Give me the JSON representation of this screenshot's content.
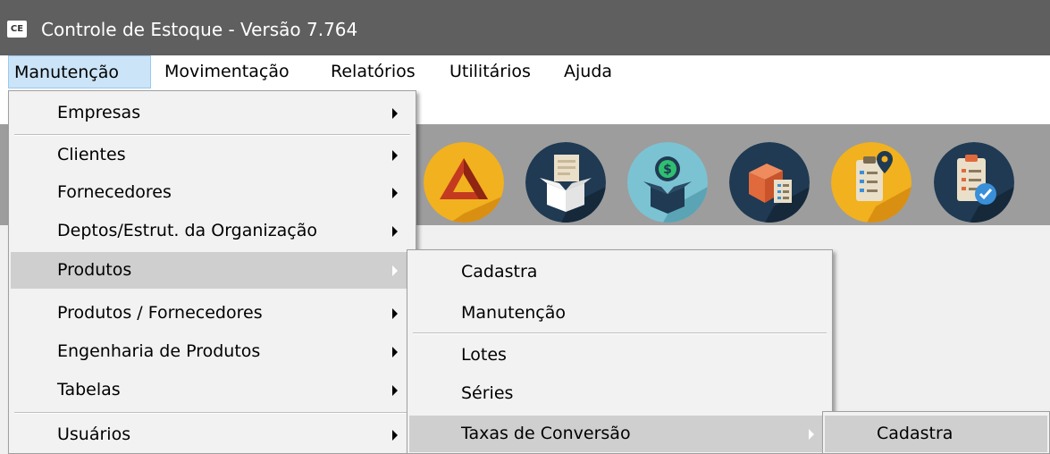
{
  "window": {
    "app_icon_text": "CE",
    "title": "Controle de Estoque - Versão 7.764"
  },
  "menubar": {
    "items": [
      "Manutenção",
      "Movimentação",
      "Relatórios",
      "Utilitários",
      "Ajuda"
    ],
    "active": "Manutenção"
  },
  "toolbar": {
    "icons": [
      "triangle-logo-icon",
      "open-box-document-icon",
      "box-dollar-icon",
      "box-checklist-icon",
      "clipboard-location-icon",
      "clipboard-check-icon"
    ]
  },
  "menu_manutencao": {
    "items": [
      "Empresas",
      "Clientes",
      "Fornecedores",
      "Deptos/Estrut. da Organização",
      "Produtos",
      "Produtos / Fornecedores",
      "Engenharia de Produtos",
      "Tabelas",
      "Usuários"
    ],
    "highlighted": "Produtos"
  },
  "menu_produtos": {
    "items": [
      "Cadastra",
      "Manutenção",
      "Lotes",
      "Séries",
      "Taxas de Conversão"
    ],
    "highlighted": "Taxas de Conversão"
  },
  "menu_taxas": {
    "items": [
      "Cadastra"
    ],
    "highlighted": "Cadastra"
  },
  "colors": {
    "titlebar": "#5f5f5f",
    "toolbar": "#9d9d9d",
    "menu_highlight": "#cfcfcf",
    "menubar_active": "#cce4f7"
  }
}
